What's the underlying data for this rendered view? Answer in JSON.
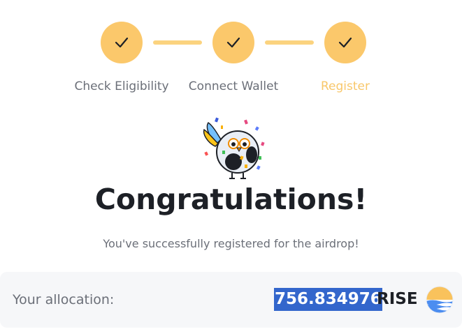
{
  "stepper": {
    "steps": [
      {
        "label": "Check Eligibility",
        "state": "completed",
        "icon": "check-icon"
      },
      {
        "label": "Connect Wallet",
        "state": "completed",
        "icon": "check-icon"
      },
      {
        "label": "Register",
        "state": "active",
        "icon": "check-icon"
      }
    ]
  },
  "mascot": {
    "icon": "bird-mascot-confetti-icon"
  },
  "success": {
    "title": "Congratulations!",
    "message": "You've successfully registered for the airdrop!"
  },
  "allocation": {
    "label": "Your allocation:",
    "amount": "756.834976",
    "token": "RISE",
    "token_icon": "rise-token-icon"
  },
  "colors": {
    "accent": "#fbc86b",
    "active_label": "#f8c76a",
    "text_dark": "#1d2026",
    "text_muted": "#6b6f78",
    "selection": "#3366cc",
    "card_bg": "#f6f7f9"
  }
}
